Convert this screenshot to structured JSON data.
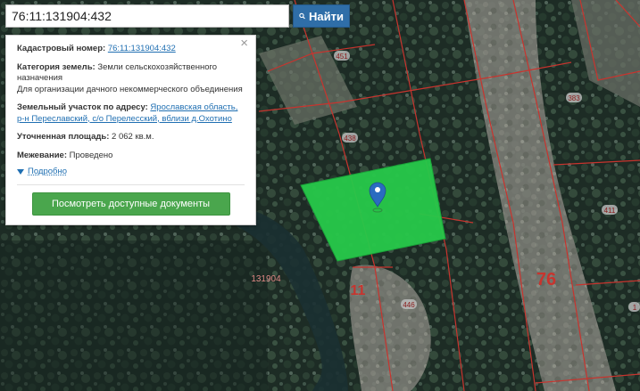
{
  "search": {
    "value": "76:11:131904:432",
    "button_label": "Найти"
  },
  "info": {
    "cadastral_label": "Кадастровый номер:",
    "cadastral_value": "76:11:131904:432",
    "category_label": "Категория земель:",
    "category_value": "Земли сельскохозяйственного назначения",
    "purpose": "Для организации дачного некоммерческого объединения",
    "address_label": "Земельный участок по адресу:",
    "address_value": "Ярославская область, р-н Переславский, с/о Перелесский, вблизи д.Охотино",
    "area_label": "Уточненная площадь:",
    "area_value": "2 062 кв.м.",
    "survey_label": "Межевание:",
    "survey_value": "Проведено",
    "details_label": "Подробно",
    "docs_button": "Посмотреть доступные документы",
    "close": "×"
  },
  "map_labels": {
    "p451": "451",
    "p438": "438",
    "p383": "383",
    "p411": "411",
    "p446": "446",
    "p1": "1",
    "block": "131904",
    "region": "76",
    "n11": "11"
  },
  "colors": {
    "boundary": "#c8342e",
    "parcel_fill": "#27c94a",
    "marker": "#2a6cc0",
    "button_blue": "#2f6ea8",
    "button_green": "#4aa64d"
  }
}
